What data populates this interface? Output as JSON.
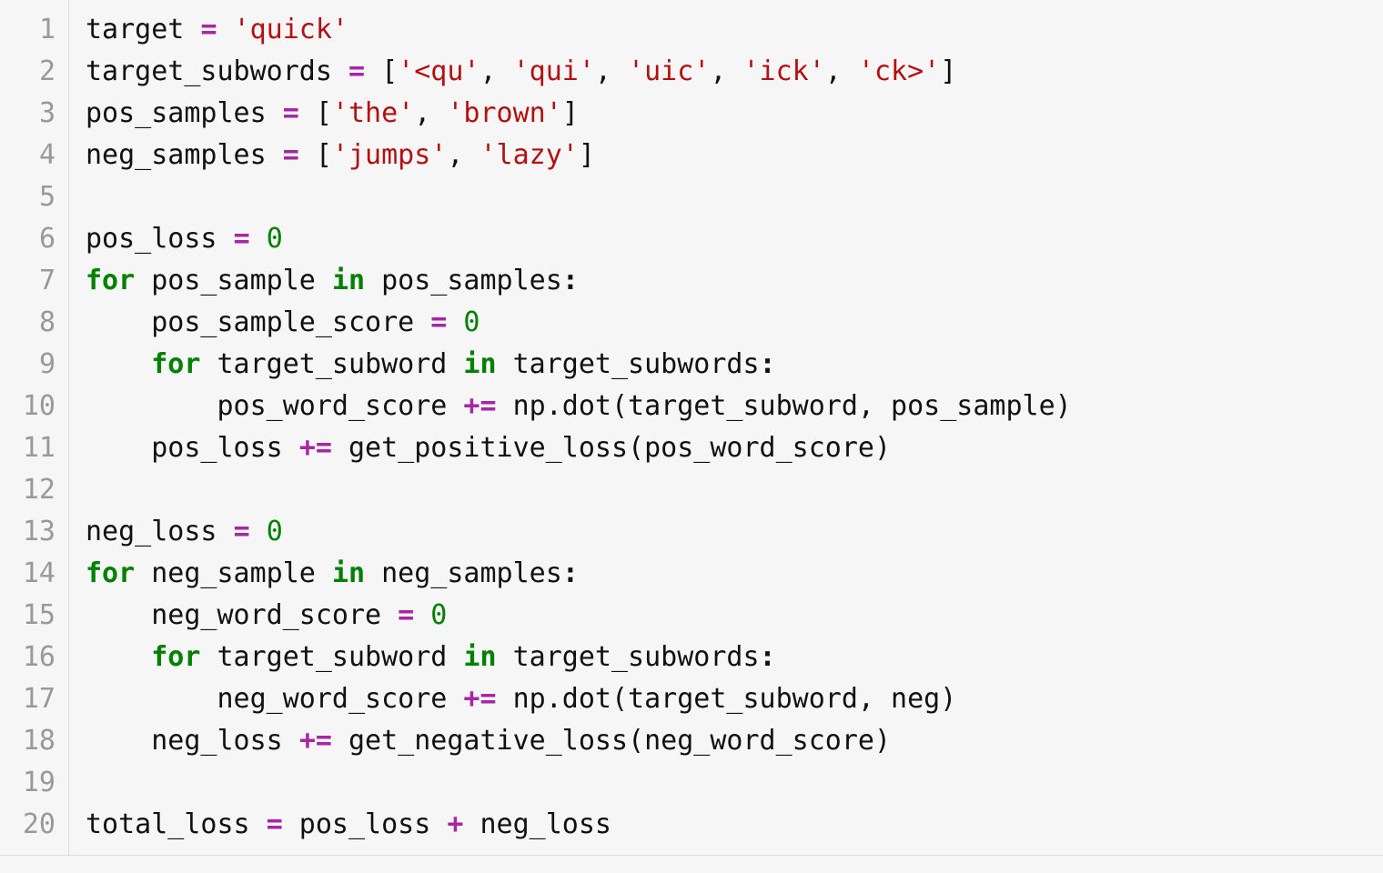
{
  "code": {
    "line_numbers": [
      "1",
      "2",
      "3",
      "4",
      "5",
      "6",
      "7",
      "8",
      "9",
      "10",
      "11",
      "12",
      "13",
      "14",
      "15",
      "16",
      "17",
      "18",
      "19",
      "20"
    ],
    "lines": [
      [
        {
          "t": "target ",
          "c": "id"
        },
        {
          "t": "=",
          "c": "op"
        },
        {
          "t": " ",
          "c": "id"
        },
        {
          "t": "'quick'",
          "c": "str"
        }
      ],
      [
        {
          "t": "target_subwords ",
          "c": "id"
        },
        {
          "t": "=",
          "c": "op"
        },
        {
          "t": " [",
          "c": "pun"
        },
        {
          "t": "'<qu'",
          "c": "str"
        },
        {
          "t": ", ",
          "c": "pun"
        },
        {
          "t": "'qui'",
          "c": "str"
        },
        {
          "t": ", ",
          "c": "pun"
        },
        {
          "t": "'uic'",
          "c": "str"
        },
        {
          "t": ", ",
          "c": "pun"
        },
        {
          "t": "'ick'",
          "c": "str"
        },
        {
          "t": ", ",
          "c": "pun"
        },
        {
          "t": "'ck>'",
          "c": "str"
        },
        {
          "t": "]",
          "c": "pun"
        }
      ],
      [
        {
          "t": "pos_samples ",
          "c": "id"
        },
        {
          "t": "=",
          "c": "op"
        },
        {
          "t": " [",
          "c": "pun"
        },
        {
          "t": "'the'",
          "c": "str"
        },
        {
          "t": ", ",
          "c": "pun"
        },
        {
          "t": "'brown'",
          "c": "str"
        },
        {
          "t": "]",
          "c": "pun"
        }
      ],
      [
        {
          "t": "neg_samples ",
          "c": "id"
        },
        {
          "t": "=",
          "c": "op"
        },
        {
          "t": " [",
          "c": "pun"
        },
        {
          "t": "'jumps'",
          "c": "str"
        },
        {
          "t": ", ",
          "c": "pun"
        },
        {
          "t": "'lazy'",
          "c": "str"
        },
        {
          "t": "]",
          "c": "pun"
        }
      ],
      [],
      [
        {
          "t": "pos_loss ",
          "c": "id"
        },
        {
          "t": "=",
          "c": "op"
        },
        {
          "t": " ",
          "c": "id"
        },
        {
          "t": "0",
          "c": "num"
        }
      ],
      [
        {
          "t": "for",
          "c": "kw"
        },
        {
          "t": " pos_sample ",
          "c": "id"
        },
        {
          "t": "in",
          "c": "kw"
        },
        {
          "t": " pos_samples",
          "c": "id"
        },
        {
          "t": ":",
          "c": "2pun"
        }
      ],
      [
        {
          "t": "    pos_sample_score ",
          "c": "id"
        },
        {
          "t": "=",
          "c": "op"
        },
        {
          "t": " ",
          "c": "id"
        },
        {
          "t": "0",
          "c": "num"
        }
      ],
      [
        {
          "t": "    ",
          "c": "id"
        },
        {
          "t": "for",
          "c": "kw"
        },
        {
          "t": " target_subword ",
          "c": "id"
        },
        {
          "t": "in",
          "c": "kw"
        },
        {
          "t": " target_subwords",
          "c": "id"
        },
        {
          "t": ":",
          "c": "2pun"
        }
      ],
      [
        {
          "t": "        pos_word_score ",
          "c": "id"
        },
        {
          "t": "+=",
          "c": "op"
        },
        {
          "t": " np",
          "c": "id"
        },
        {
          "t": ".",
          "c": "pun"
        },
        {
          "t": "dot(target_subword, pos_sample)",
          "c": "id"
        }
      ],
      [
        {
          "t": "    pos_loss ",
          "c": "id"
        },
        {
          "t": "+=",
          "c": "op"
        },
        {
          "t": " get_positive_loss(pos_word_score)",
          "c": "id"
        }
      ],
      [],
      [
        {
          "t": "neg_loss ",
          "c": "id"
        },
        {
          "t": "=",
          "c": "op"
        },
        {
          "t": " ",
          "c": "id"
        },
        {
          "t": "0",
          "c": "num"
        }
      ],
      [
        {
          "t": "for",
          "c": "kw"
        },
        {
          "t": " neg_sample ",
          "c": "id"
        },
        {
          "t": "in",
          "c": "kw"
        },
        {
          "t": " neg_samples",
          "c": "id"
        },
        {
          "t": ":",
          "c": "2pun"
        }
      ],
      [
        {
          "t": "    neg_word_score ",
          "c": "id"
        },
        {
          "t": "=",
          "c": "op"
        },
        {
          "t": " ",
          "c": "id"
        },
        {
          "t": "0",
          "c": "num"
        }
      ],
      [
        {
          "t": "    ",
          "c": "id"
        },
        {
          "t": "for",
          "c": "kw"
        },
        {
          "t": " target_subword ",
          "c": "id"
        },
        {
          "t": "in",
          "c": "kw"
        },
        {
          "t": " target_subwords",
          "c": "id"
        },
        {
          "t": ":",
          "c": "2pun"
        }
      ],
      [
        {
          "t": "        neg_word_score ",
          "c": "id"
        },
        {
          "t": "+=",
          "c": "op"
        },
        {
          "t": " np",
          "c": "id"
        },
        {
          "t": ".",
          "c": "pun"
        },
        {
          "t": "dot(target_subword, neg)",
          "c": "id"
        }
      ],
      [
        {
          "t": "    neg_loss ",
          "c": "id"
        },
        {
          "t": "+=",
          "c": "op"
        },
        {
          "t": " get_negative_loss(neg_word_score)",
          "c": "id"
        }
      ],
      [],
      [
        {
          "t": "total_loss ",
          "c": "id"
        },
        {
          "t": "=",
          "c": "op"
        },
        {
          "t": " pos_loss ",
          "c": "id"
        },
        {
          "t": "+",
          "c": "op"
        },
        {
          "t": " neg_loss",
          "c": "id"
        }
      ]
    ]
  }
}
